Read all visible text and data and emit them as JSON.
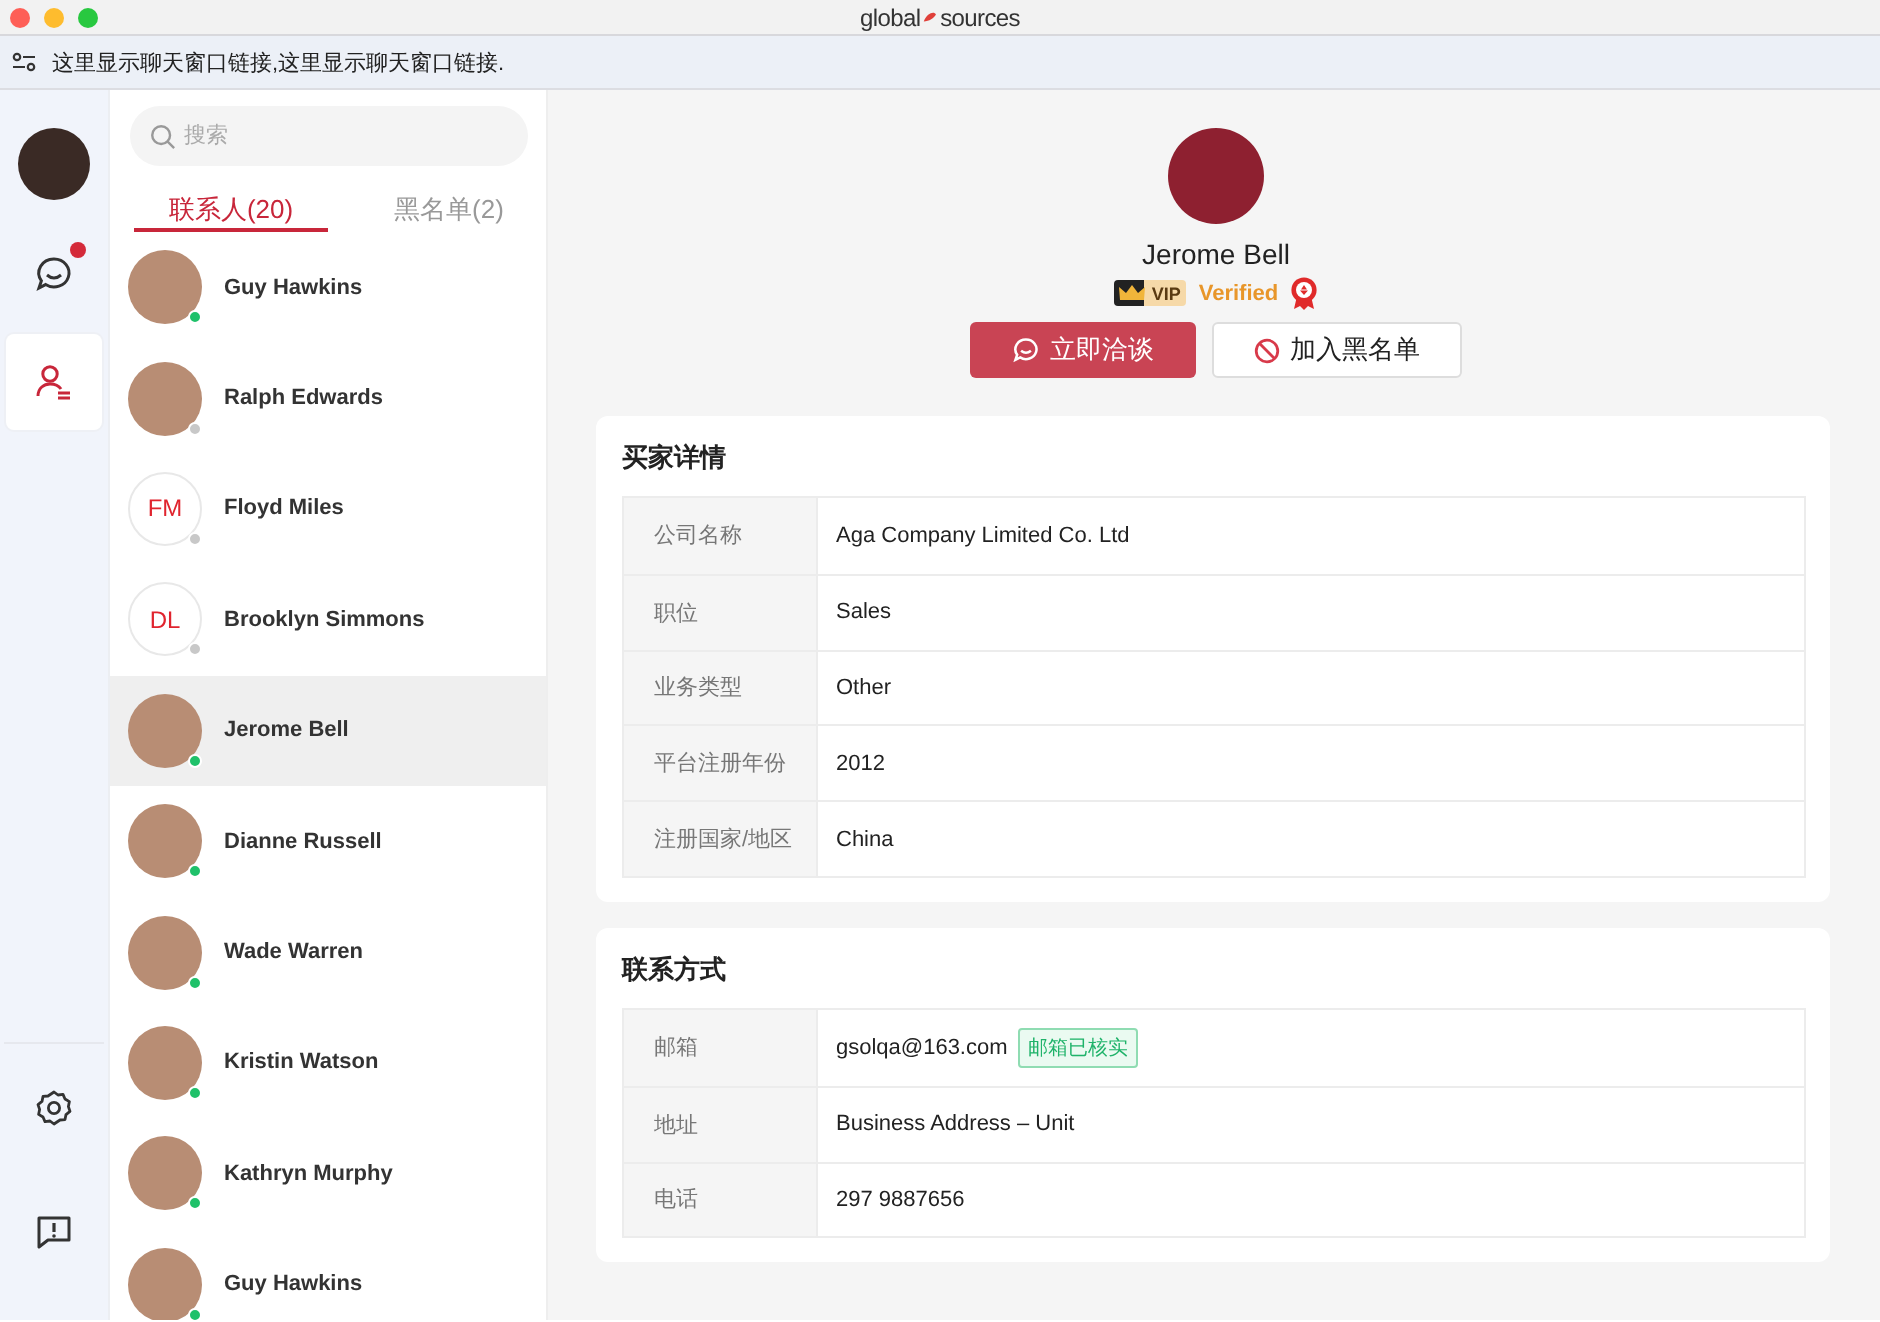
{
  "window": {
    "logo_left": "global",
    "logo_right": "sources"
  },
  "link_bar": {
    "text": "这里显示聊天窗口链接,这里显示聊天窗口链接."
  },
  "nav_rail": [
    {
      "kind": "avatar"
    },
    {
      "kind": "chat",
      "selected": false,
      "badge": true
    },
    {
      "kind": "contacts",
      "selected": true,
      "badge": false
    },
    {
      "kind": "settings",
      "selected": false,
      "badge": false
    },
    {
      "kind": "feedback",
      "selected": false,
      "badge": false
    }
  ],
  "search": {
    "placeholder": "搜索"
  },
  "tabs": [
    {
      "label": "联系人(20)",
      "selected": true
    },
    {
      "label": "黑名单(2)",
      "selected": false
    }
  ],
  "contacts": [
    {
      "name": "Guy Hawkins",
      "online": true,
      "selected": false
    },
    {
      "name": "Ralph Edwards",
      "online": false,
      "selected": false
    },
    {
      "name": "Floyd Miles",
      "initials": "FM",
      "online": false,
      "selected": false
    },
    {
      "name": "Brooklyn Simmons",
      "initials": "DL",
      "online": false,
      "selected": false
    },
    {
      "name": "Jerome Bell",
      "online": true,
      "selected": true
    },
    {
      "name": "Dianne Russell",
      "online": true,
      "selected": false
    },
    {
      "name": "Wade Warren",
      "online": true,
      "selected": false
    },
    {
      "name": "Kristin Watson",
      "online": true,
      "selected": false
    },
    {
      "name": "Kathryn Murphy",
      "online": true,
      "selected": false
    },
    {
      "name": "Guy Hawkins",
      "online": true,
      "selected": false
    }
  ],
  "profile": {
    "name": "Jerome Bell",
    "vip": "VIP",
    "verified": "Verified",
    "buttons": [
      {
        "kind": "primary",
        "label": "立即洽谈"
      },
      {
        "kind": "secondary",
        "label": "加入黑名单"
      }
    ]
  },
  "sections": [
    {
      "title": "买家详情",
      "rows": [
        {
          "label": "公司名称",
          "value": "Aga Company Limited Co. Ltd"
        },
        {
          "label": "职位",
          "value": "Sales"
        },
        {
          "label": "业务类型",
          "value": "Other"
        },
        {
          "label": "平台注册年份",
          "value": "2012"
        },
        {
          "label": "注册国家/地区",
          "value": "China"
        }
      ]
    },
    {
      "title": "联系方式",
      "rows": [
        {
          "label": "邮箱",
          "value": "gsolqa@163.com",
          "tag": "邮箱已核实"
        },
        {
          "label": "地址",
          "value": "Business Address – Unit"
        },
        {
          "label": "电话",
          "value": "297 9887656"
        }
      ]
    }
  ]
}
